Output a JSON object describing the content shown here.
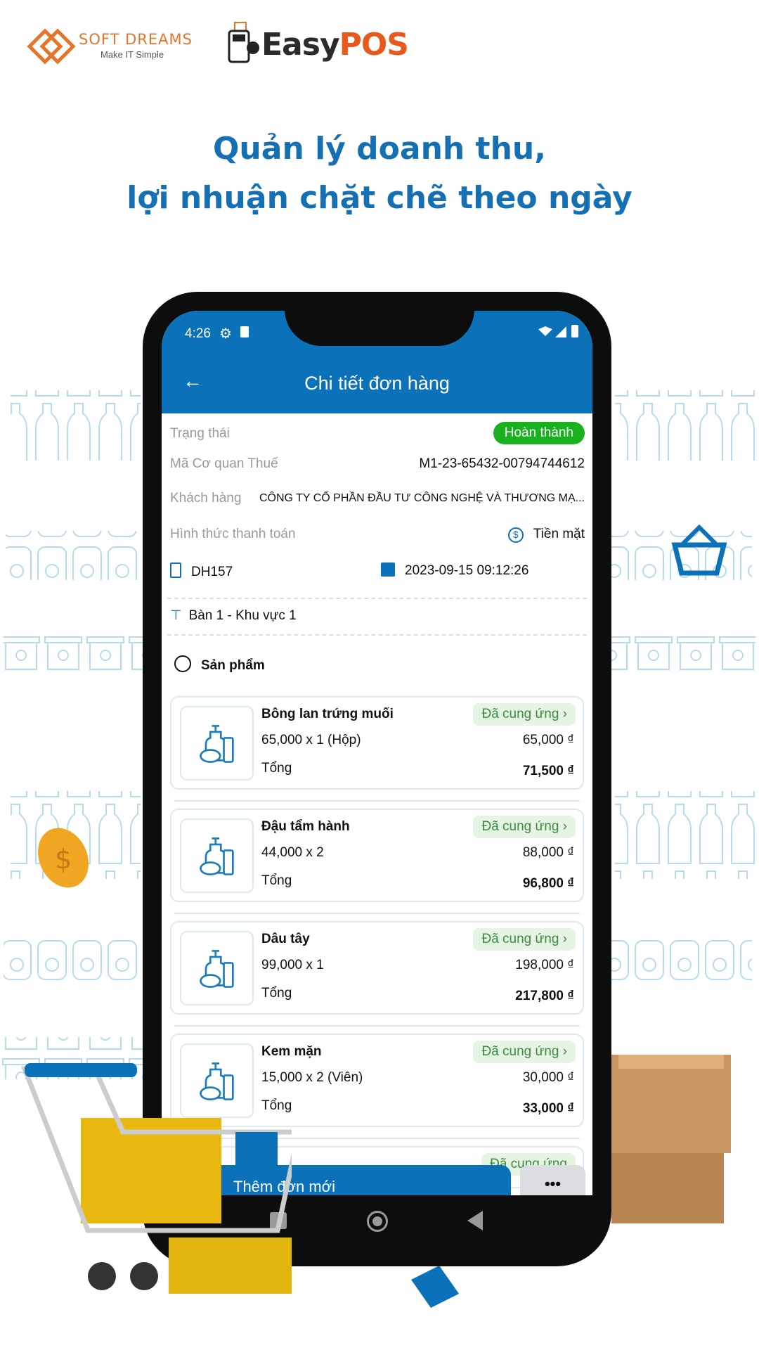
{
  "branding": {
    "softdreams_title": "SOFT DREAMS",
    "softdreams_tagline": "Make IT Simple",
    "easypos_prefix": "Easy",
    "easypos_suffix": "POS"
  },
  "headline": {
    "line1": "Quản lý doanh thu,",
    "line2": "lợi nhuận chặt chẽ theo ngày"
  },
  "status_bar": {
    "time": "4:26"
  },
  "app_bar": {
    "title": "Chi tiết đơn hàng",
    "back_icon": "arrow-left-icon"
  },
  "order": {
    "status_label": "Trạng thái",
    "status_value": "Hoàn thành",
    "tax_label": "Mã Cơ quan Thuế",
    "tax_value": "M1-23-65432-00794744612",
    "customer_label": "Khách hàng",
    "customer_value": "CÔNG TY CỐ PHẦN ĐẦU TƯ CÔNG NGHỆ VÀ THƯƠNG MẠ...",
    "payment_label": "Hình thức thanh toán",
    "payment_value": "Tiền mặt",
    "code": "DH157",
    "datetime": "2023-09-15 09:12:26",
    "table": "Bàn 1 - Khu vực 1",
    "products_heading": "Sản phẩm"
  },
  "products": [
    {
      "name": "Bông lan trứng muối",
      "qty": "65,000  x 1 (Hộp)",
      "line_total": "65,000 ₫",
      "total_label": "Tổng",
      "total": "71,500 ₫",
      "status": "Đã cung ứng"
    },
    {
      "name": "Đậu tẩm hành",
      "qty": "44,000  x 2",
      "line_total": "88,000 ₫",
      "total_label": "Tổng",
      "total": "96,800 ₫",
      "status": "Đã cung ứng"
    },
    {
      "name": "Dâu tây",
      "qty": "99,000  x 1",
      "line_total": "198,000 ₫",
      "total_label": "Tổng",
      "total": "217,800 ₫",
      "status": "Đã cung ứng"
    },
    {
      "name": "Kem mặn",
      "qty": "15,000  x 2 (Viên)",
      "line_total": "30,000 ₫",
      "total_label": "Tổng",
      "total": "33,000 ₫",
      "status": "Đã cung ứng"
    }
  ],
  "bottom": {
    "new_order": "Thêm đơn mới",
    "more": "•••"
  },
  "colors": {
    "primary": "#0b72b9",
    "success": "#19b11e",
    "accent": "#e8742a"
  }
}
